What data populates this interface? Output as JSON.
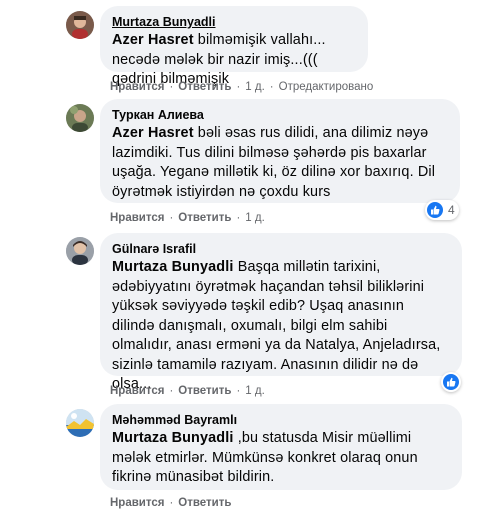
{
  "comments": [
    {
      "author": "Murtaza Bunyadli",
      "mention": "Azer Hasret",
      "text": " bilməmişik vallahı... necədə mələk bir nazir imiş...((( qədrini bilməmişik",
      "actions": {
        "like": "Нравится",
        "reply": "Ответить",
        "time": "1 д.",
        "edited": "Отредактировано"
      },
      "reactions": null
    },
    {
      "author": "Туркан Алиева",
      "mention": "Azer Hasret",
      "text": " bəli əsas rus dilidi, ana dilimiz nəyə lazimdiki. Tus dilini bilməsə şəhərdə pis baxarlar uşağa. Yeganə millətik ki, öz dilinə xor baxırıq. Dil öyrətmək istiyirdən nə çoxdu kurs",
      "actions": {
        "like": "Нравится",
        "reply": "Ответить",
        "time": "1 д."
      },
      "reactions": {
        "icon": "like-icon",
        "count": "4"
      }
    },
    {
      "author": "Gülnarə Israfil",
      "mention": "Murtaza Bunyadli",
      "text": " Başqa millətin tarixini, ədəbiyyatını öyrətmək haçandan təhsil biliklərini yüksək səviyyədə təşkil edib? Uşaq anasının dilində danışmalı, oxumalı, bilgi elm sahibi olmalıdır, anası erməni ya da Natalya, Anjeladırsa, sizinlə tamamilə razıyam. Anasının dilidir nə də olsa...",
      "actions": {
        "like": "Нравится",
        "reply": "Ответить",
        "time": "1 д."
      },
      "reactions": {
        "icon": "like-icon",
        "count": ""
      }
    },
    {
      "author": "Məhəmməd Bayramlı",
      "mention": "Murtaza Bunyadli",
      "text": " ,bu statusda Misir müəllimi mələk etmirlər. Mümkünsə konkret olaraq onun fikrinə münasibət bildirin.",
      "actions": {
        "like": "Нравится",
        "reply": "Ответить"
      },
      "reactions": null
    }
  ],
  "colors": {
    "bubble": "#f0f2f5",
    "meta": "#65676b",
    "like": "#1877f2"
  }
}
